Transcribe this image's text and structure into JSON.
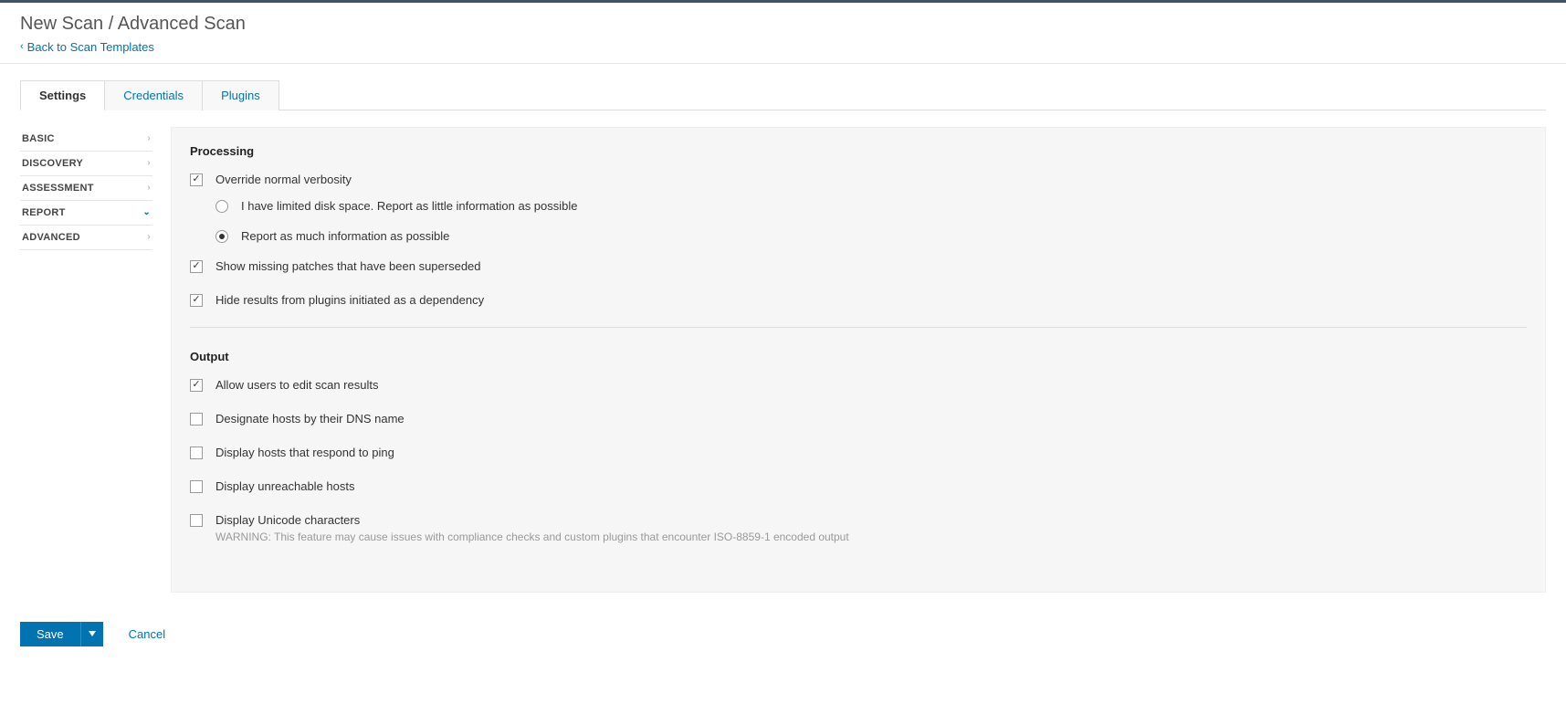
{
  "header": {
    "title": "New Scan / Advanced Scan",
    "back_label": "Back to Scan Templates"
  },
  "tabs": [
    {
      "label": "Settings",
      "active": true
    },
    {
      "label": "Credentials",
      "active": false
    },
    {
      "label": "Plugins",
      "active": false
    }
  ],
  "sidebar": {
    "items": [
      {
        "label": "BASIC",
        "expanded": false
      },
      {
        "label": "DISCOVERY",
        "expanded": false
      },
      {
        "label": "ASSESSMENT",
        "expanded": false
      },
      {
        "label": "REPORT",
        "expanded": true
      },
      {
        "label": "ADVANCED",
        "expanded": false
      }
    ]
  },
  "processing": {
    "title": "Processing",
    "override": {
      "label": "Override normal verbosity",
      "checked": true
    },
    "radios": {
      "limited": {
        "label": "I have limited disk space. Report as little information as possible",
        "selected": false
      },
      "much": {
        "label": "Report as much information as possible",
        "selected": true
      }
    },
    "superseded": {
      "label": "Show missing patches that have been superseded",
      "checked": true
    },
    "dependency": {
      "label": "Hide results from plugins initiated as a dependency",
      "checked": true
    }
  },
  "output": {
    "title": "Output",
    "edit": {
      "label": "Allow users to edit scan results",
      "checked": true
    },
    "dns": {
      "label": "Designate hosts by their DNS name",
      "checked": false
    },
    "ping": {
      "label": "Display hosts that respond to ping",
      "checked": false
    },
    "unreach": {
      "label": "Display unreachable hosts",
      "checked": false
    },
    "unicode": {
      "label": "Display Unicode characters",
      "checked": false,
      "warning": "WARNING: This feature may cause issues with compliance checks and custom plugins that encounter ISO-8859-1 encoded output"
    }
  },
  "footer": {
    "save_label": "Save",
    "cancel_label": "Cancel"
  }
}
